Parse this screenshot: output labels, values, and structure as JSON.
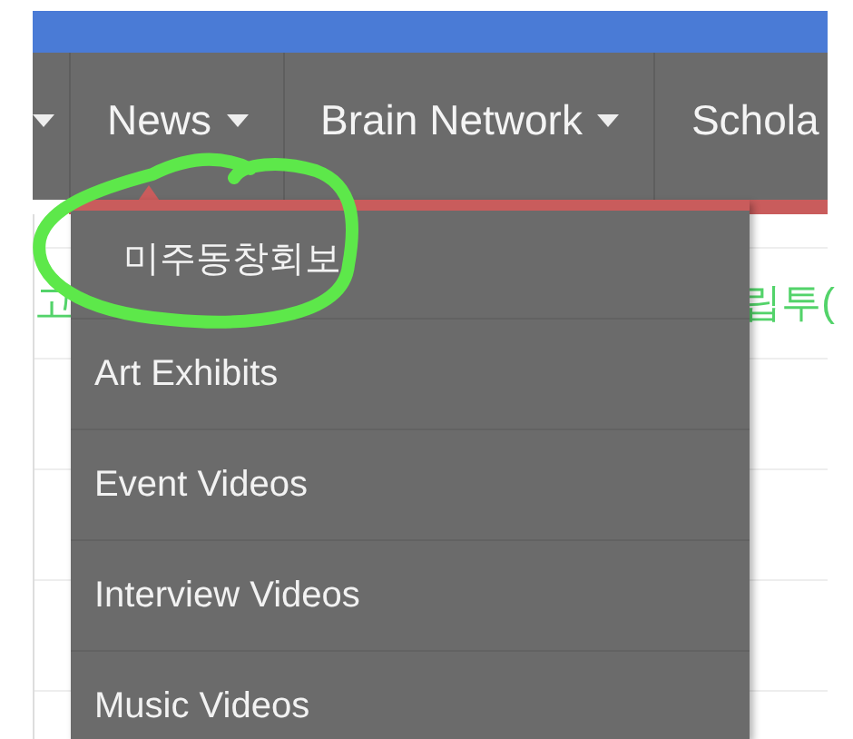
{
  "nav": {
    "items": [
      {
        "caret": true,
        "expanded": false
      },
      {
        "label": "News",
        "caret": true,
        "expanded": true
      },
      {
        "label": "Brain Network",
        "caret": true,
        "expanded": false
      },
      {
        "label": "Schola",
        "caret": false,
        "expanded": false
      }
    ]
  },
  "dropdown": {
    "items": [
      {
        "label": "미주동창회보",
        "circled": true
      },
      {
        "label": "Art Exhibits",
        "circled": false
      },
      {
        "label": "Event Videos",
        "circled": false
      },
      {
        "label": "Interview Videos",
        "circled": false
      },
      {
        "label": "Music Videos",
        "circled": false
      }
    ]
  },
  "page": {
    "left_text": "고",
    "right_text": "립투("
  }
}
